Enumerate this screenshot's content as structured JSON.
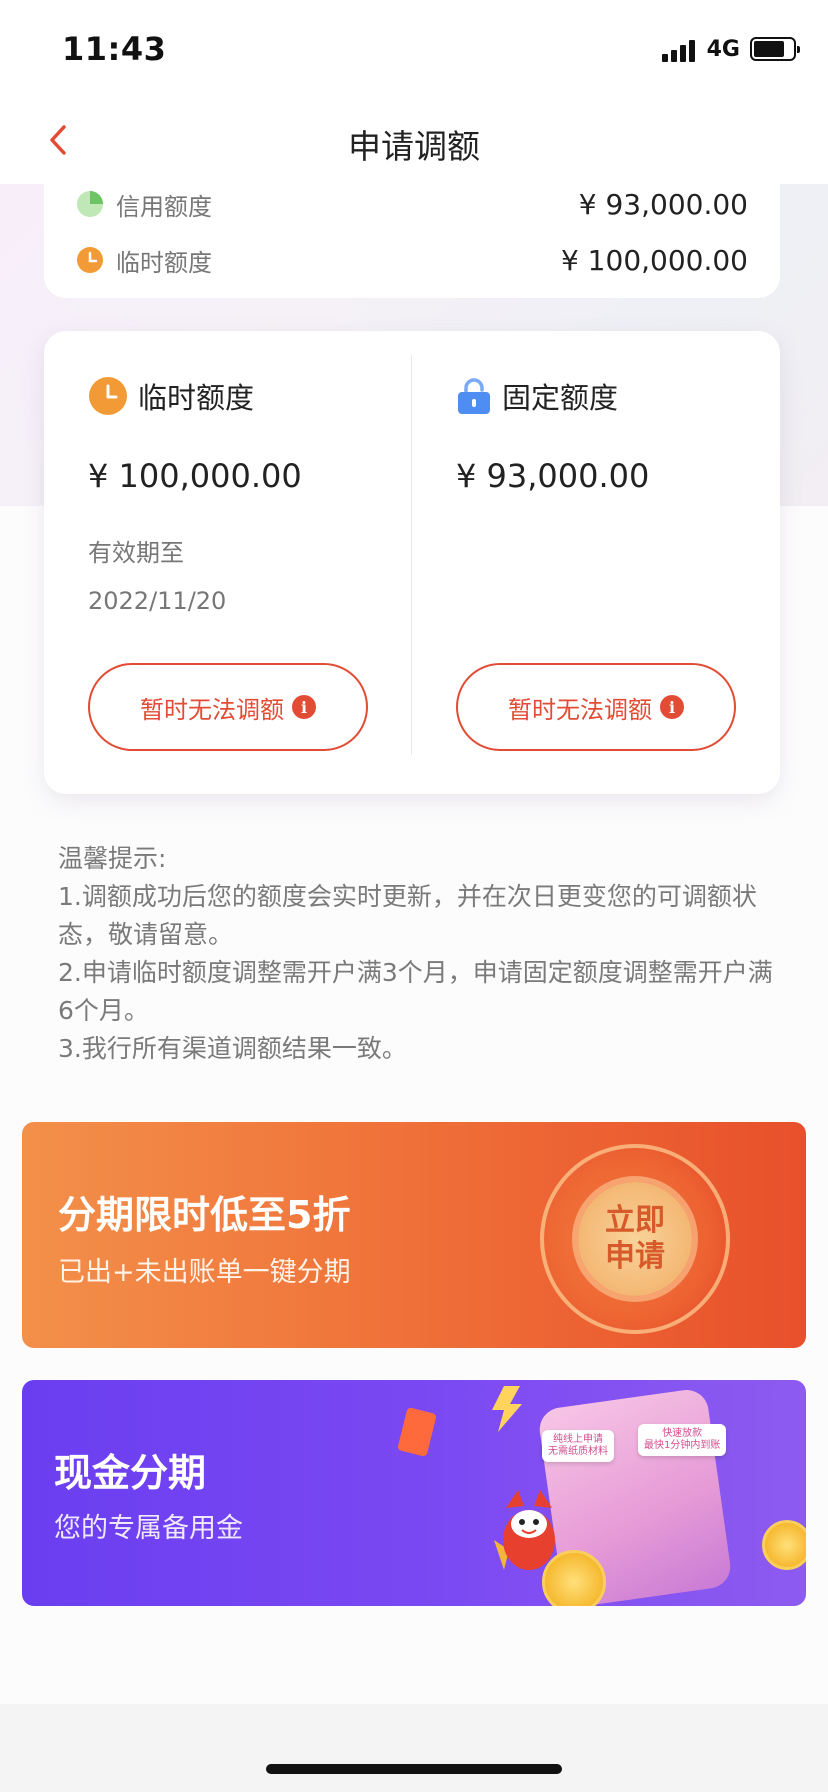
{
  "status_bar": {
    "time": "11:43",
    "network": "4G"
  },
  "nav": {
    "title": "申请调额"
  },
  "summary": {
    "credit_label": "信用额度",
    "credit_value": "¥ 93,000.00",
    "temp_label": "临时额度",
    "temp_value": "¥ 100,000.00"
  },
  "quota_card": {
    "temporary": {
      "title": "临时额度",
      "amount": "¥ 100,000.00",
      "expire_label": "有效期至",
      "expire_date": "2022/11/20",
      "button_label": "暂时无法调额"
    },
    "fixed": {
      "title": "固定额度",
      "amount": "¥ 93,000.00",
      "button_label": "暂时无法调额"
    }
  },
  "tips": {
    "heading": "温馨提示:",
    "lines": [
      "1.调额成功后您的额度会实时更新，并在次日更变您的可调额状态，敬请留意。",
      "2.申请临时额度调整需开户满3个月，申请固定额度调整需开户满6个月。",
      "3.我行所有渠道调额结果一致。"
    ]
  },
  "banners": {
    "installment": {
      "title": "分期限时低至5折",
      "subtitle": "已出+未出账单一键分期",
      "apply_line1": "立即",
      "apply_line2": "申请"
    },
    "cash": {
      "title": "现金分期",
      "subtitle": "您的专属备用金",
      "chip1_line1": "纯线上申请",
      "chip1_line2": "无需纸质材料",
      "chip2_line1": "快速放款",
      "chip2_line2": "最快1分钟内到账"
    }
  },
  "colors": {
    "accent_red": "#e24b34",
    "clock_orange": "#f29a35",
    "lock_blue": "#4e8ef2",
    "pie_green": "#8fd48a"
  }
}
